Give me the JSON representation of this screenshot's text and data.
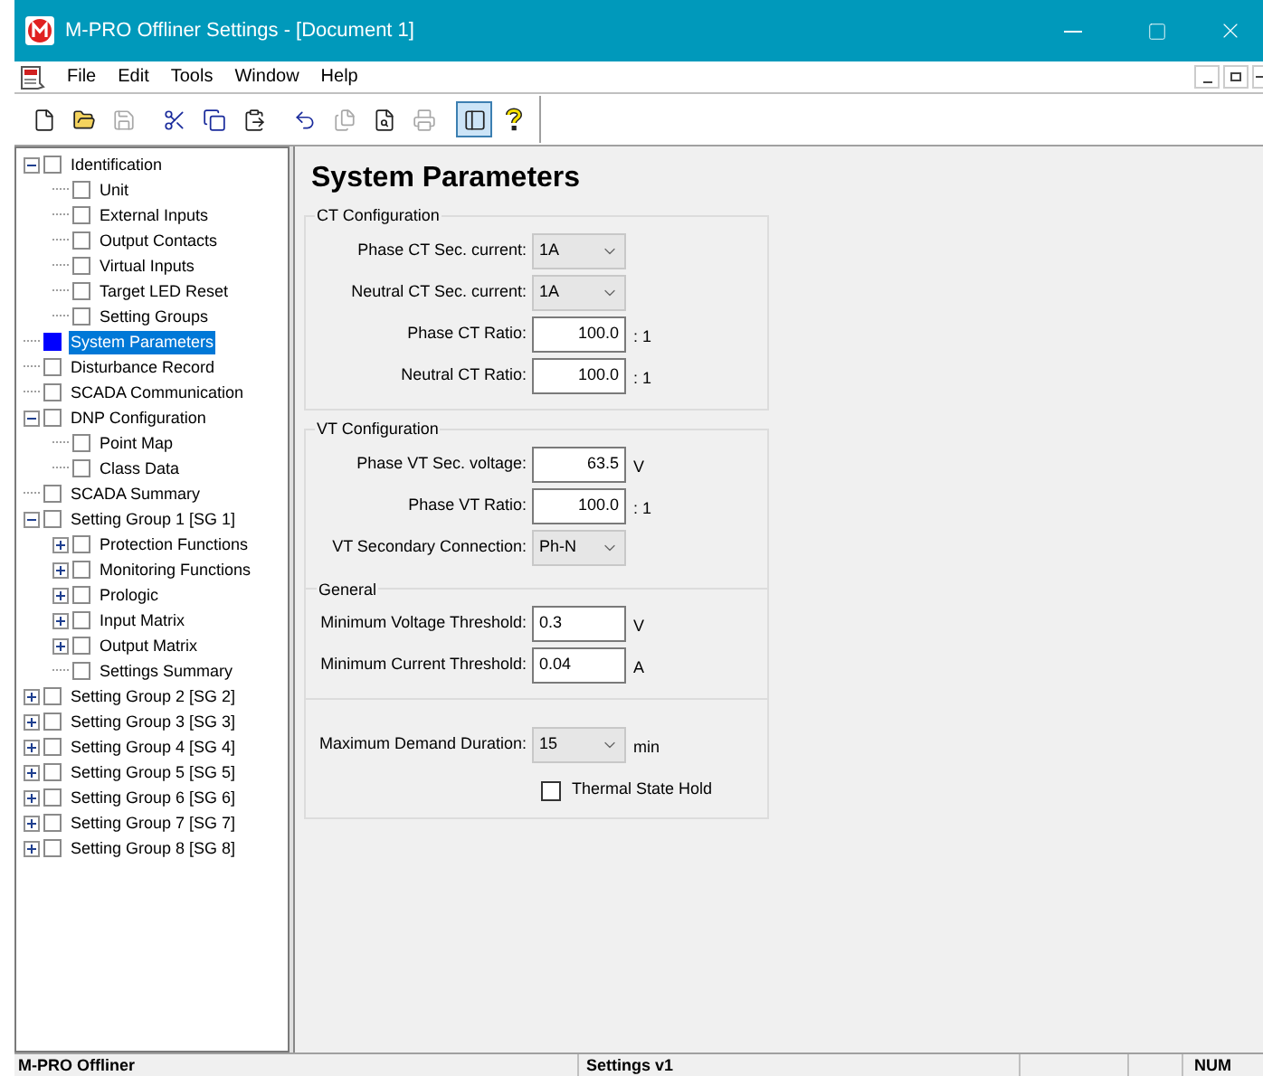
{
  "window": {
    "title": "M-PRO Offliner Settings - [Document 1]"
  },
  "menu": [
    "File",
    "Edit",
    "Tools",
    "Window",
    "Help"
  ],
  "toolbar": [
    {
      "disabled": false,
      "pressed": false
    },
    {
      "disabled": false,
      "pressed": false
    },
    {
      "disabled": true,
      "pressed": false
    },
    {
      "disabled": false,
      "pressed": false
    },
    {
      "disabled": false,
      "pressed": false
    },
    {
      "disabled": false,
      "pressed": false
    },
    {
      "disabled": false,
      "pressed": false
    },
    {
      "disabled": true,
      "pressed": false
    },
    {
      "disabled": false,
      "pressed": false
    },
    {
      "disabled": true,
      "pressed": false
    },
    {
      "disabled": false,
      "pressed": true
    },
    {
      "disabled": false,
      "pressed": false
    }
  ],
  "tree": [
    {
      "label": "Identification",
      "kind": "branch",
      "expanded": true,
      "selected": false,
      "children": [
        {
          "label": "Unit",
          "kind": "leaf",
          "selected": false
        },
        {
          "label": "External Inputs",
          "kind": "leaf",
          "selected": false
        },
        {
          "label": "Output Contacts",
          "kind": "leaf",
          "selected": false
        },
        {
          "label": "Virtual Inputs",
          "kind": "leaf",
          "selected": false
        },
        {
          "label": "Target LED Reset",
          "kind": "leaf",
          "selected": false
        },
        {
          "label": "Setting Groups",
          "kind": "leaf",
          "selected": false
        }
      ]
    },
    {
      "label": "System Parameters",
      "kind": "leaf",
      "selected": true
    },
    {
      "label": "Disturbance Record",
      "kind": "leaf",
      "selected": false
    },
    {
      "label": "SCADA Communication",
      "kind": "leaf",
      "selected": false
    },
    {
      "label": "DNP Configuration",
      "kind": "branch",
      "expanded": true,
      "selected": false,
      "children": [
        {
          "label": "Point Map",
          "kind": "leaf",
          "selected": false
        },
        {
          "label": "Class Data",
          "kind": "leaf",
          "selected": false
        }
      ]
    },
    {
      "label": "SCADA Summary",
      "kind": "leaf",
      "selected": false
    },
    {
      "label": "Setting Group 1 [SG 1]",
      "kind": "branch",
      "expanded": true,
      "selected": false,
      "children": [
        {
          "label": "Protection Functions",
          "kind": "branch",
          "expanded": false,
          "selected": false
        },
        {
          "label": "Monitoring Functions",
          "kind": "branch",
          "expanded": false,
          "selected": false
        },
        {
          "label": "Prologic",
          "kind": "branch",
          "expanded": false,
          "selected": false
        },
        {
          "label": "Input Matrix",
          "kind": "branch",
          "expanded": false,
          "selected": false
        },
        {
          "label": "Output Matrix",
          "kind": "branch",
          "expanded": false,
          "selected": false
        },
        {
          "label": "Settings Summary",
          "kind": "leaf",
          "selected": false
        }
      ]
    },
    {
      "label": "Setting Group 2 [SG 2]",
      "kind": "branch",
      "expanded": false,
      "selected": false
    },
    {
      "label": "Setting Group 3 [SG 3]",
      "kind": "branch",
      "expanded": false,
      "selected": false
    },
    {
      "label": "Setting Group 4 [SG 4]",
      "kind": "branch",
      "expanded": false,
      "selected": false
    },
    {
      "label": "Setting Group 5 [SG 5]",
      "kind": "branch",
      "expanded": false,
      "selected": false
    },
    {
      "label": "Setting Group 6 [SG 6]",
      "kind": "branch",
      "expanded": false,
      "selected": false
    },
    {
      "label": "Setting Group 7 [SG 7]",
      "kind": "branch",
      "expanded": false,
      "selected": false
    },
    {
      "label": "Setting Group 8 [SG 8]",
      "kind": "branch",
      "expanded": false,
      "selected": false
    }
  ],
  "page": {
    "title": "System Parameters",
    "groups": [
      {
        "title": "CT Configuration",
        "sections": [
          {
            "rows": [
              {
                "kind": "dropdown",
                "label": "Phase CT Sec. current:",
                "value": "1A"
              },
              {
                "kind": "dropdown",
                "label": "Neutral CT Sec. current:",
                "value": "1A"
              },
              {
                "kind": "number",
                "label": "Phase CT Ratio:",
                "value": "100.0",
                "unit": ": 1"
              },
              {
                "kind": "number",
                "label": "Neutral CT Ratio:",
                "value": "100.0",
                "unit": ": 1"
              }
            ]
          }
        ]
      },
      {
        "title": "VT Configuration",
        "sections": [
          {
            "rows": [
              {
                "kind": "number",
                "label": "Phase VT Sec. voltage:",
                "value": "63.5",
                "unit": "V"
              },
              {
                "kind": "number",
                "label": "Phase VT Ratio:",
                "value": "100.0",
                "unit": ": 1"
              },
              {
                "kind": "dropdown",
                "label": "VT Secondary Connection:",
                "value": "Ph-N"
              }
            ]
          },
          {
            "title": "General",
            "rows": [
              {
                "kind": "text",
                "label": "Minimum Voltage Threshold:",
                "value": "0.3",
                "unit": "V"
              },
              {
                "kind": "text",
                "label": "Minimum Current Threshold:",
                "value": "0.04",
                "unit": "A"
              }
            ]
          },
          {
            "rows": [
              {
                "kind": "dropdown",
                "label": "Maximum Demand Duration:",
                "value": "15",
                "unit": "min"
              },
              {
                "kind": "checkbox",
                "label": "Thermal State Hold",
                "checked": false
              }
            ]
          }
        ]
      }
    ]
  },
  "status_bar": [
    "M-PRO Offliner",
    "Settings v1",
    "NUM"
  ]
}
